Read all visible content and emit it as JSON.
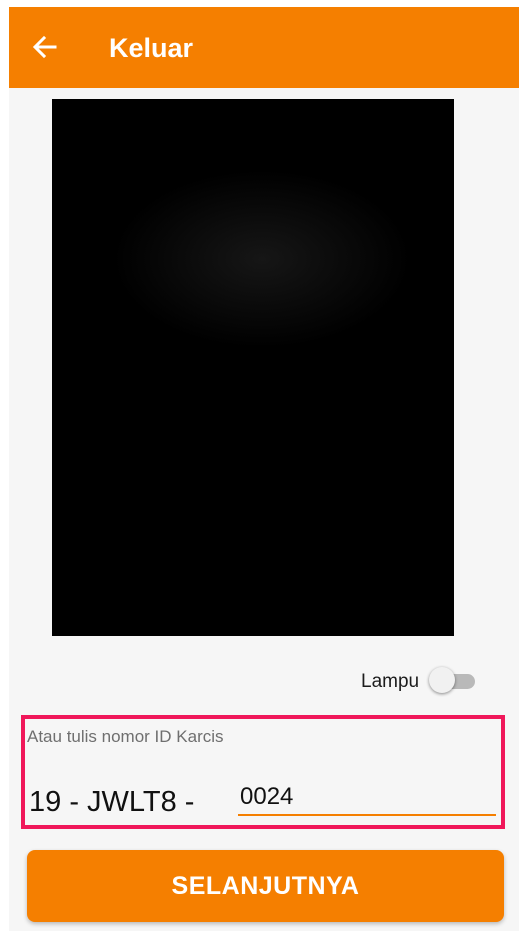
{
  "appbar": {
    "title": "Keluar",
    "back_icon": "arrow-left-icon",
    "color": "#f57f00"
  },
  "camera": {
    "preview": "camera-preview"
  },
  "lamp": {
    "label": "Lampu",
    "enabled": false
  },
  "ticket": {
    "hint": "Atau tulis nomor ID Karcis",
    "prefix": "19 - JWLT8 -",
    "value": "0024",
    "highlight_color": "#f0185a"
  },
  "actions": {
    "next_label": "SELANJUTNYA"
  }
}
